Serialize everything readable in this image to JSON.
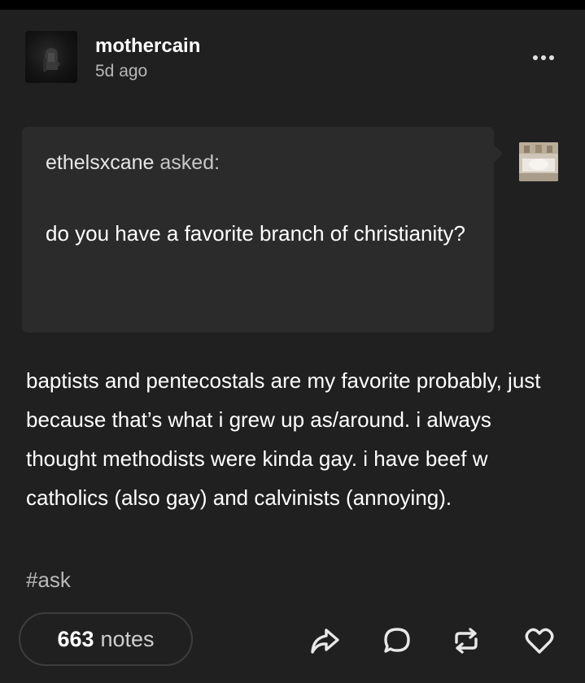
{
  "post": {
    "author": "mothercain",
    "timestamp": "5d ago",
    "menu_icon": "more-horizontal-icon"
  },
  "ask": {
    "asker": "ethelsxcane",
    "asked_label": "asked:",
    "question": "do you have a favorite branch of christianity?"
  },
  "answer": {
    "text": "baptists and pentecostals are my favorite probably, just because that’s what i grew up as/around. i always thought methodists were kinda gay. i have beef w catholics (also gay) and calvinists (annoying)."
  },
  "tags": [
    "#ask"
  ],
  "footer": {
    "notes_count": "663",
    "notes_label": "notes",
    "actions": [
      "share-icon",
      "reply-icon",
      "reblog-icon",
      "like-icon"
    ]
  },
  "colors": {
    "page_background": "#000000",
    "post_background": "#202020",
    "ask_background": "#2b2b2b",
    "primary_text": "#ffffff",
    "secondary_text": "#b8b8b8"
  }
}
